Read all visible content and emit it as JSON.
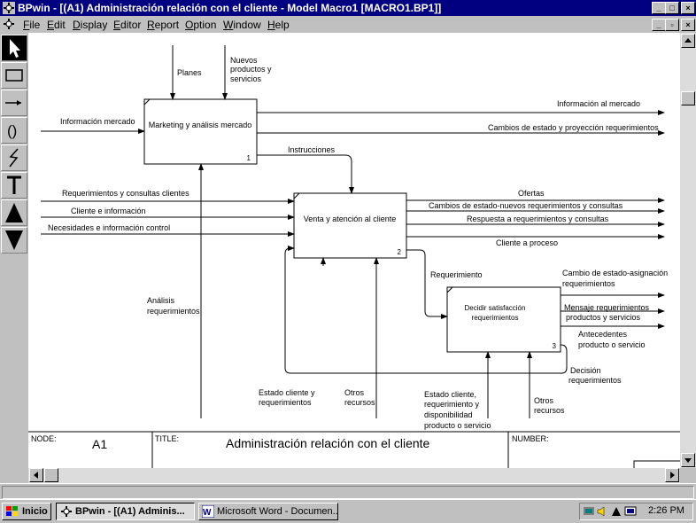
{
  "window": {
    "title": "BPwin - [(A1) Administración relación con el cliente - Model Macro1  [MACRO1.BP1]]"
  },
  "menu": [
    "File",
    "Edit",
    "Display",
    "Editor",
    "Report",
    "Option",
    "Window",
    "Help"
  ],
  "toolbox": [
    "pointer-tool",
    "box-tool",
    "arrow-tool",
    "squiggle-tool",
    "lightning-tool",
    "text-tool",
    "up-tool",
    "down-tool"
  ],
  "diagram": {
    "boxes": [
      {
        "name": "Marketing y análisis mercado",
        "num": "1"
      },
      {
        "name": "Venta y atención al cliente",
        "num": "2"
      },
      {
        "name": "Decidir satisfacción requerimientos",
        "num": "3"
      }
    ],
    "labels": {
      "planes": "Planes",
      "nuevos1": "Nuevos",
      "nuevos2": "productos y",
      "nuevos3": "servicios",
      "info_mercado_in": "Información mercado",
      "info_al_mercado": "Información al mercado",
      "cambios_proy": "Cambios de estado y proyección requerimientos",
      "instrucciones": "Instrucciones",
      "req_consultas": "Requerimientos y consultas clientes",
      "cliente_info": "Cliente e información",
      "necesidades": "Necesidades e información control",
      "ofertas": "Ofertas",
      "cambios_nuevos": "Cambios de estado-nuevos requerimientos y consultas",
      "respuesta": "Respuesta a requerimientos y consultas",
      "cliente_proceso": "Cliente a proceso",
      "requerimiento": "Requerimiento",
      "cambio_asig1": "Cambio de estado-asignación",
      "cambio_asig2": "requerimientos",
      "mensaje1": "Mensaje requerimientos",
      "mensaje2": "productos y servicios",
      "antecedentes1": "Antecedentes",
      "antecedentes2": "producto o servicio",
      "decision1": "Decisión",
      "decision2": "requerimientos",
      "analisis1": "Análisis",
      "analisis2": "requerimientos",
      "estado_cli1": "Estado cliente y",
      "estado_cli2": "requerimientos",
      "otros1a": "Otros",
      "otros1b": "recursos",
      "estado2a": "Estado cliente,",
      "estado2b": "requerimiento y",
      "estado2c": "disponibilidad",
      "estado2d": "producto o servicio",
      "otros2a": "Otros",
      "otros2b": "recursos"
    },
    "footer": {
      "node_label": "NODE:",
      "node_value": "A1",
      "title_label": "TITLE:",
      "title_value": "Administración relación con el cliente",
      "number_label": "NUMBER:"
    }
  },
  "taskbar": {
    "start": "Inicio",
    "task1": "BPwin - [(A1) Adminis...",
    "task2": "Microsoft Word - Documen...",
    "clock": "2:26 PM"
  },
  "colors": {
    "titlebar": "#000080",
    "face": "#c0c0c0",
    "canvas": "#ffffff"
  }
}
